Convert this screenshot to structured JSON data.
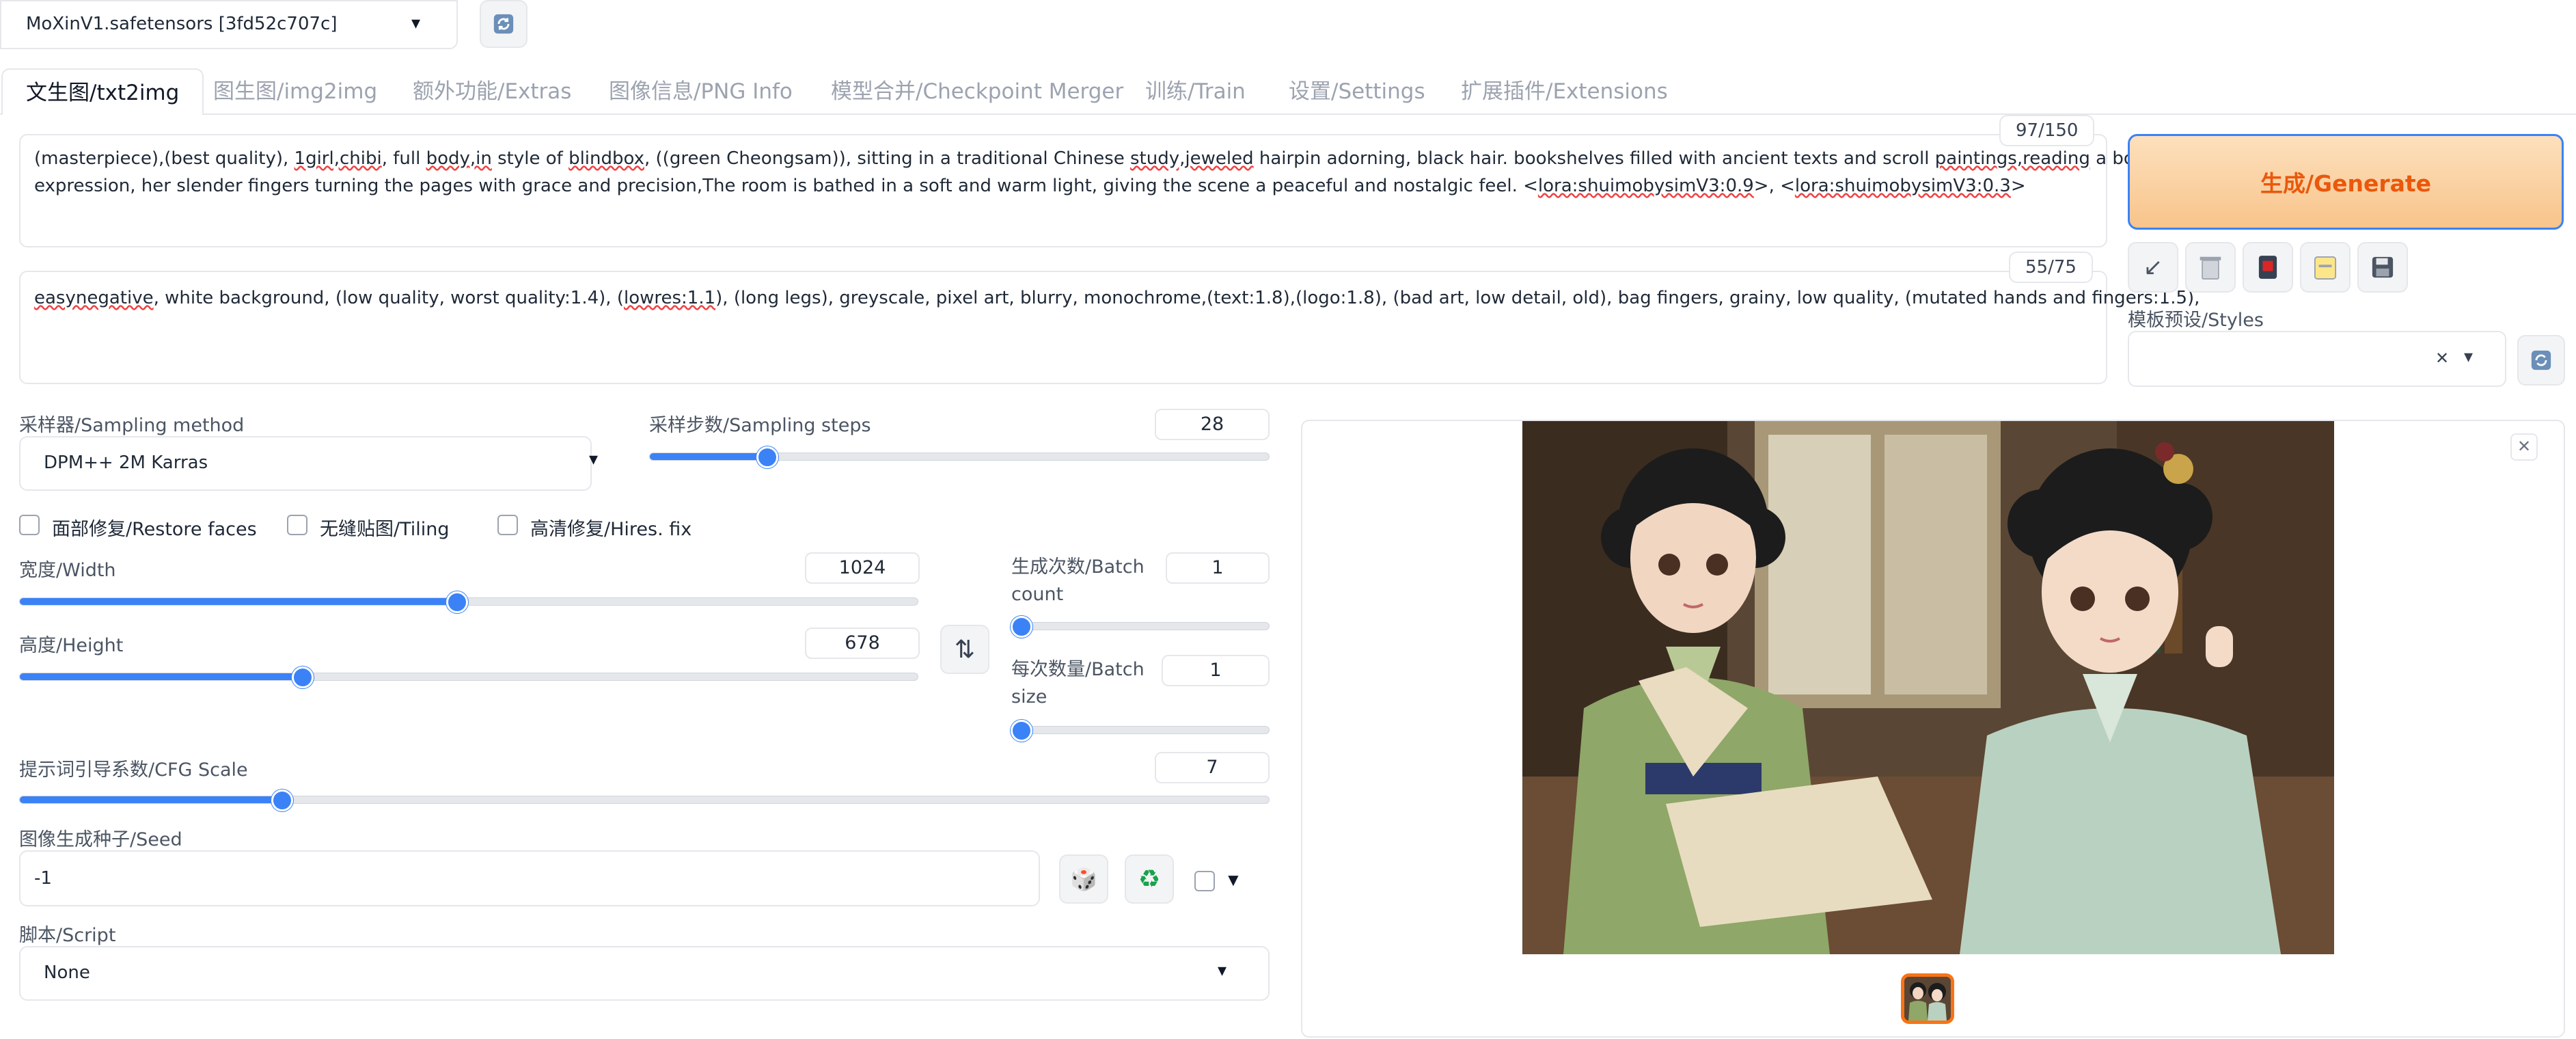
{
  "model": {
    "checkpoint": "MoXinV1.safetensors [3fd52c707c]"
  },
  "tabs": [
    {
      "label": "文生图/txt2img",
      "active": true
    },
    {
      "label": "图生图/img2img"
    },
    {
      "label": "额外功能/Extras"
    },
    {
      "label": "图像信息/PNG Info"
    },
    {
      "label": "模型合并/Checkpoint Merger"
    },
    {
      "label": "训练/Train"
    },
    {
      "label": "设置/Settings"
    },
    {
      "label": "扩展插件/Extensions"
    }
  ],
  "prompt": {
    "counter": "97/150",
    "p1": "(masterpiece),(best quality), ",
    "w1": "1girl,chibi",
    "p2": ", full ",
    "w2": "body,in",
    "p3": " style of ",
    "w3": "blindbox",
    "p4": ", ((green Cheongsam)), sitting in a traditional Chinese ",
    "w4": "study,jeweled",
    "p5": " hairpin adorning, black hair. bookshelves filled with ancient texts and scroll ",
    "w5": "paintings,reading",
    "p6": " a book with a focused",
    "line2a": "expression, her slender fingers turning the pages with grace and precision,The room is bathed in a soft and warm light, giving the scene a peaceful and nostalgic feel. <",
    "w6": "lora:shuimobysimV3:0.9",
    "line2b": ">, <",
    "w7": "lora:shuimobysimV3:0.3",
    "line2c": ">"
  },
  "negative_prompt": {
    "counter": "55/75",
    "w1": "easynegative",
    "p1": ", white background, (low quality, worst quality:1.4), (",
    "w2": "lowres:1.1",
    "p2": "), (long legs), greyscale, pixel art, blurry, monochrome,(text:1.8),(logo:1.8), (bad art, low detail, old), bag fingers, grainy, low quality, (mutated hands and fingers:1.5),"
  },
  "generate": {
    "label": "生成/Generate"
  },
  "styles": {
    "label": "模板预设/Styles",
    "clear_icon": "✕",
    "dropdown_icon": "▾"
  },
  "sampler": {
    "label": "采样器/Sampling method",
    "value": "DPM++ 2M Karras"
  },
  "steps": {
    "label": "采样步数/Sampling steps",
    "value": "28",
    "fraction": 0.19
  },
  "checkboxes": {
    "restore_faces": "面部修复/Restore faces",
    "tiling": "无缝贴图/Tiling",
    "hires": "高清修复/Hires. fix"
  },
  "width": {
    "label": "宽度/Width",
    "value": "1024",
    "fraction": 0.487
  },
  "height": {
    "label": "高度/Height",
    "value": "678",
    "fraction": 0.315
  },
  "batch_count": {
    "label1": "生成次数/Batch",
    "label2": "count",
    "value": "1",
    "fraction": 0
  },
  "batch_size": {
    "label1": "每次数量/Batch",
    "label2": "size",
    "value": "1",
    "fraction": 0
  },
  "cfg": {
    "label": "提示词引导系数/CFG Scale",
    "value": "7",
    "fraction": 0.21
  },
  "seed": {
    "label": "图像生成种子/Seed",
    "value": "-1"
  },
  "script": {
    "label": "脚本/Script",
    "value": "None"
  },
  "icons": {
    "refresh": "refresh-icon",
    "swap": "⇅",
    "dice": "🎲",
    "recycle": "♻",
    "close": "✕",
    "extra": "▼"
  },
  "colors": {
    "accent": "#3b82f6",
    "generate_bg": "#fcd9b0",
    "generate_text": "#ea580c",
    "thumb_border": "#f97316"
  }
}
